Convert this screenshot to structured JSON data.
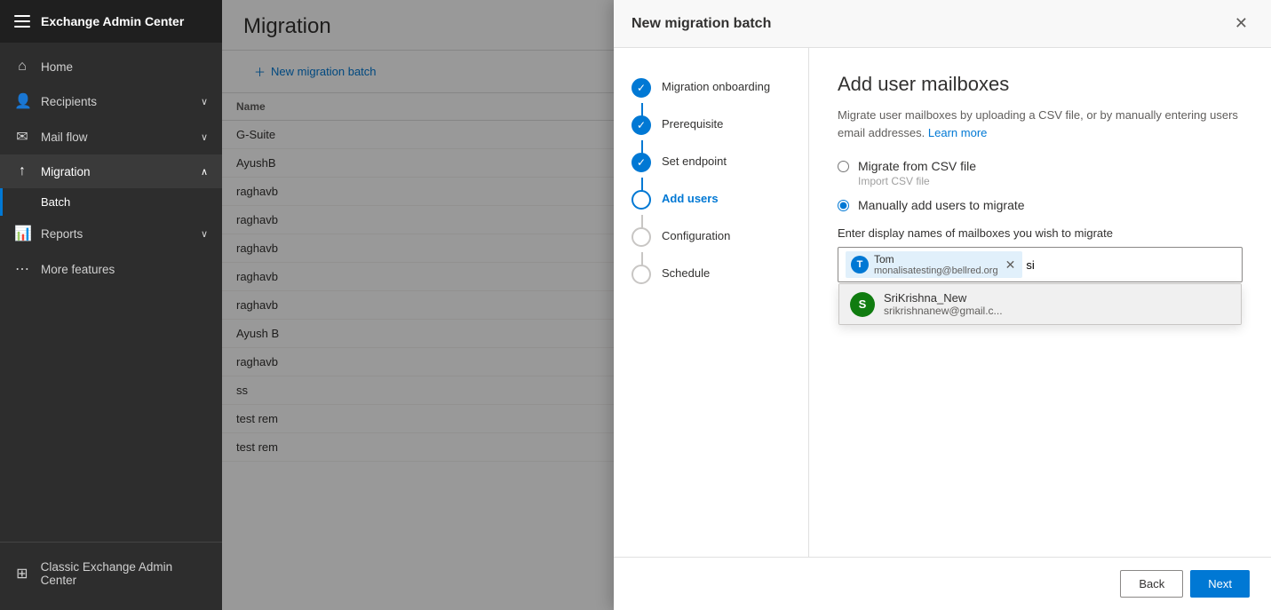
{
  "app": {
    "title": "Exchange Admin Center"
  },
  "sidebar": {
    "hamburger_label": "menu",
    "items": [
      {
        "id": "home",
        "label": "Home",
        "icon": "⌂",
        "has_chevron": false
      },
      {
        "id": "recipients",
        "label": "Recipients",
        "icon": "👤",
        "has_chevron": true
      },
      {
        "id": "mail-flow",
        "label": "Mail flow",
        "icon": "✉",
        "has_chevron": true
      },
      {
        "id": "migration",
        "label": "Migration",
        "icon": "↑",
        "has_chevron": true
      },
      {
        "id": "batch",
        "label": "Batch",
        "is_sub": true
      },
      {
        "id": "reports",
        "label": "Reports",
        "icon": "📊",
        "has_chevron": true
      },
      {
        "id": "more-features",
        "label": "More features",
        "icon": "⋯",
        "has_chevron": false
      }
    ],
    "bottom_item": {
      "label": "Classic Exchange Admin Center",
      "icon": "⊞"
    }
  },
  "main": {
    "title": "Migration",
    "toolbar": {
      "new_migration_label": "New migration batch"
    },
    "table": {
      "columns": [
        "Name"
      ],
      "rows": [
        {
          "name": "G-Suite"
        },
        {
          "name": "AyushB"
        },
        {
          "name": "raghavb"
        },
        {
          "name": "raghavb"
        },
        {
          "name": "raghavb"
        },
        {
          "name": "raghavb"
        },
        {
          "name": "raghavb"
        },
        {
          "name": "Ayush B"
        },
        {
          "name": "raghavb"
        },
        {
          "name": "ss"
        },
        {
          "name": "test rem"
        },
        {
          "name": "test rem"
        }
      ]
    }
  },
  "modal": {
    "title": "New migration batch",
    "close_label": "✕",
    "steps": [
      {
        "id": "migration-onboarding",
        "label": "Migration onboarding",
        "state": "completed"
      },
      {
        "id": "prerequisite",
        "label": "Prerequisite",
        "state": "completed"
      },
      {
        "id": "set-endpoint",
        "label": "Set endpoint",
        "state": "completed"
      },
      {
        "id": "add-users",
        "label": "Add users",
        "state": "current"
      },
      {
        "id": "configuration",
        "label": "Configuration",
        "state": "upcoming"
      },
      {
        "id": "schedule",
        "label": "Schedule",
        "state": "upcoming"
      }
    ],
    "content": {
      "title": "Add user mailboxes",
      "description": "Migrate user mailboxes by uploading a CSV file, or by manually entering users email addresses.",
      "learn_more_label": "Learn more",
      "options": [
        {
          "id": "csv",
          "label": "Migrate from CSV file",
          "sub_label": "Import CSV file",
          "selected": false
        },
        {
          "id": "manual",
          "label": "Manually add users to migrate",
          "sub_label": "",
          "selected": true
        }
      ],
      "manual_input": {
        "label": "Enter display names of mailboxes you wish to migrate",
        "tags": [
          {
            "avatar_initial": "T",
            "avatar_color": "#0078d4",
            "name": "Tom",
            "email": "monalisatesting@bellred.org"
          }
        ],
        "current_input": "si",
        "autocomplete": [
          {
            "avatar_initial": "S",
            "avatar_color": "#107c10",
            "name": "SriKrishna_New",
            "email": "srikrishnanew@gmail.c..."
          }
        ]
      }
    },
    "footer": {
      "back_label": "Back",
      "next_label": "Next"
    }
  }
}
